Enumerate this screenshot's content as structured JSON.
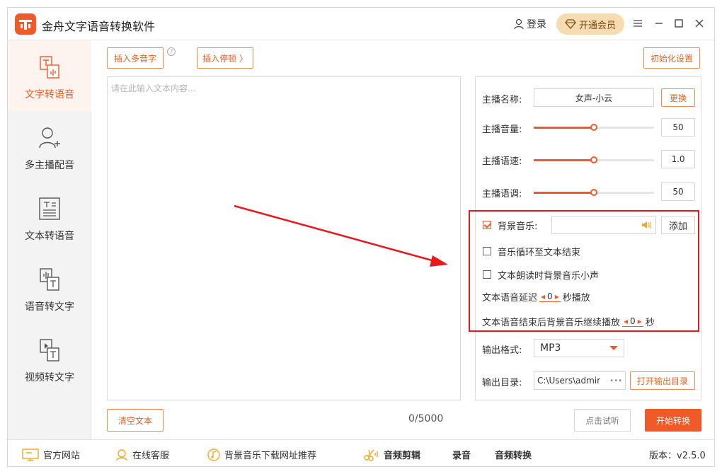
{
  "app": {
    "title": "金舟文字语音转换软件",
    "login_label": "登录",
    "vip_label": "开通会员",
    "accent_color": "#f05a28"
  },
  "sidebar": {
    "items": [
      {
        "label": "文字转语音",
        "icon": "text-speech-icon",
        "active": true
      },
      {
        "label": "多主播配音",
        "icon": "user-add-icon",
        "active": false
      },
      {
        "label": "文本转语音",
        "icon": "document-icon",
        "active": false
      },
      {
        "label": "语音转文字",
        "icon": "voice-to-text-icon",
        "active": false
      },
      {
        "label": "视频转文字",
        "icon": "video-to-text-icon",
        "active": false
      }
    ]
  },
  "toolbar": {
    "insert_polyphone": "插入多音字",
    "insert_pause": "插入停顿 〉",
    "reset_settings": "初始化设置"
  },
  "editor": {
    "placeholder": "请在此输入文本内容...",
    "clear_label": "清空文本",
    "counter": "0/5000"
  },
  "settings": {
    "anchor_name_label": "主播名称:",
    "anchor_name_value": "女声-小云",
    "change_label": "更换",
    "volume_label": "主播音量:",
    "volume_value": "50",
    "volume_level": 0.5,
    "speed_label": "主播语速:",
    "speed_value": "1.0",
    "speed_level": 0.5,
    "pitch_label": "主播语调:",
    "pitch_value": "50",
    "pitch_level": 0.5,
    "bgm_label": "背景音乐:",
    "bgm_checked": true,
    "add_label": "添加",
    "loop_label": "音乐循环至文本结束",
    "loop_checked": false,
    "duck_label": "文本朗读时背景音乐小声",
    "duck_checked": false,
    "delay_prefix": "文本语音延迟",
    "delay_value": "0",
    "delay_suffix": "秒播放",
    "continue_prefix": "文本语音结束后背景音乐继续播放",
    "continue_value": "0",
    "continue_suffix": "秒",
    "format_label": "输出格式:",
    "format_value": "MP3",
    "dir_label": "输出目录:",
    "dir_value": "C:\\Users\\admir",
    "dir_more": "•••",
    "open_dir_label": "打开输出目录"
  },
  "actions": {
    "preview_label": "点击试听",
    "convert_label": "开始转换"
  },
  "footer": {
    "website": "官方网站",
    "service": "在线客服",
    "bgm_recommend": "背景音乐下载网址推荐",
    "audio_cut": "音频剪辑",
    "record": "录音",
    "audio_convert": "音频转换",
    "version": "版本：v2.5.0"
  }
}
